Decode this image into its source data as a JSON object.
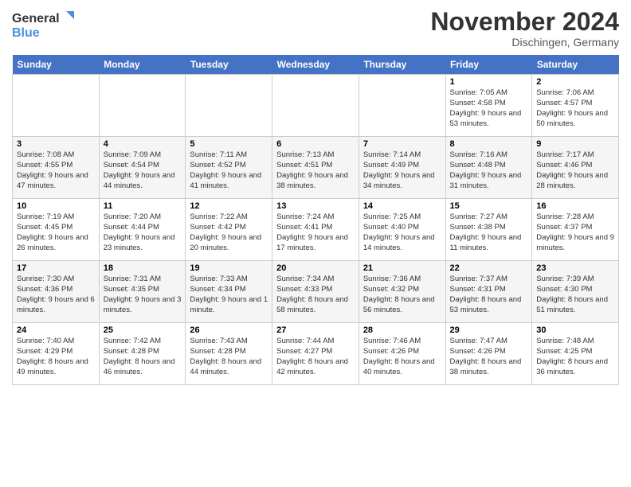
{
  "logo": {
    "line1": "General",
    "line2": "Blue"
  },
  "title": "November 2024",
  "location": "Dischingen, Germany",
  "days_header": [
    "Sunday",
    "Monday",
    "Tuesday",
    "Wednesday",
    "Thursday",
    "Friday",
    "Saturday"
  ],
  "weeks": [
    [
      {
        "day": "",
        "info": ""
      },
      {
        "day": "",
        "info": ""
      },
      {
        "day": "",
        "info": ""
      },
      {
        "day": "",
        "info": ""
      },
      {
        "day": "",
        "info": ""
      },
      {
        "day": "1",
        "info": "Sunrise: 7:05 AM\nSunset: 4:58 PM\nDaylight: 9 hours and 53 minutes."
      },
      {
        "day": "2",
        "info": "Sunrise: 7:06 AM\nSunset: 4:57 PM\nDaylight: 9 hours and 50 minutes."
      }
    ],
    [
      {
        "day": "3",
        "info": "Sunrise: 7:08 AM\nSunset: 4:55 PM\nDaylight: 9 hours and 47 minutes."
      },
      {
        "day": "4",
        "info": "Sunrise: 7:09 AM\nSunset: 4:54 PM\nDaylight: 9 hours and 44 minutes."
      },
      {
        "day": "5",
        "info": "Sunrise: 7:11 AM\nSunset: 4:52 PM\nDaylight: 9 hours and 41 minutes."
      },
      {
        "day": "6",
        "info": "Sunrise: 7:13 AM\nSunset: 4:51 PM\nDaylight: 9 hours and 38 minutes."
      },
      {
        "day": "7",
        "info": "Sunrise: 7:14 AM\nSunset: 4:49 PM\nDaylight: 9 hours and 34 minutes."
      },
      {
        "day": "8",
        "info": "Sunrise: 7:16 AM\nSunset: 4:48 PM\nDaylight: 9 hours and 31 minutes."
      },
      {
        "day": "9",
        "info": "Sunrise: 7:17 AM\nSunset: 4:46 PM\nDaylight: 9 hours and 28 minutes."
      }
    ],
    [
      {
        "day": "10",
        "info": "Sunrise: 7:19 AM\nSunset: 4:45 PM\nDaylight: 9 hours and 26 minutes."
      },
      {
        "day": "11",
        "info": "Sunrise: 7:20 AM\nSunset: 4:44 PM\nDaylight: 9 hours and 23 minutes."
      },
      {
        "day": "12",
        "info": "Sunrise: 7:22 AM\nSunset: 4:42 PM\nDaylight: 9 hours and 20 minutes."
      },
      {
        "day": "13",
        "info": "Sunrise: 7:24 AM\nSunset: 4:41 PM\nDaylight: 9 hours and 17 minutes."
      },
      {
        "day": "14",
        "info": "Sunrise: 7:25 AM\nSunset: 4:40 PM\nDaylight: 9 hours and 14 minutes."
      },
      {
        "day": "15",
        "info": "Sunrise: 7:27 AM\nSunset: 4:38 PM\nDaylight: 9 hours and 11 minutes."
      },
      {
        "day": "16",
        "info": "Sunrise: 7:28 AM\nSunset: 4:37 PM\nDaylight: 9 hours and 9 minutes."
      }
    ],
    [
      {
        "day": "17",
        "info": "Sunrise: 7:30 AM\nSunset: 4:36 PM\nDaylight: 9 hours and 6 minutes."
      },
      {
        "day": "18",
        "info": "Sunrise: 7:31 AM\nSunset: 4:35 PM\nDaylight: 9 hours and 3 minutes."
      },
      {
        "day": "19",
        "info": "Sunrise: 7:33 AM\nSunset: 4:34 PM\nDaylight: 9 hours and 1 minute."
      },
      {
        "day": "20",
        "info": "Sunrise: 7:34 AM\nSunset: 4:33 PM\nDaylight: 8 hours and 58 minutes."
      },
      {
        "day": "21",
        "info": "Sunrise: 7:36 AM\nSunset: 4:32 PM\nDaylight: 8 hours and 56 minutes."
      },
      {
        "day": "22",
        "info": "Sunrise: 7:37 AM\nSunset: 4:31 PM\nDaylight: 8 hours and 53 minutes."
      },
      {
        "day": "23",
        "info": "Sunrise: 7:39 AM\nSunset: 4:30 PM\nDaylight: 8 hours and 51 minutes."
      }
    ],
    [
      {
        "day": "24",
        "info": "Sunrise: 7:40 AM\nSunset: 4:29 PM\nDaylight: 8 hours and 49 minutes."
      },
      {
        "day": "25",
        "info": "Sunrise: 7:42 AM\nSunset: 4:28 PM\nDaylight: 8 hours and 46 minutes."
      },
      {
        "day": "26",
        "info": "Sunrise: 7:43 AM\nSunset: 4:28 PM\nDaylight: 8 hours and 44 minutes."
      },
      {
        "day": "27",
        "info": "Sunrise: 7:44 AM\nSunset: 4:27 PM\nDaylight: 8 hours and 42 minutes."
      },
      {
        "day": "28",
        "info": "Sunrise: 7:46 AM\nSunset: 4:26 PM\nDaylight: 8 hours and 40 minutes."
      },
      {
        "day": "29",
        "info": "Sunrise: 7:47 AM\nSunset: 4:26 PM\nDaylight: 8 hours and 38 minutes."
      },
      {
        "day": "30",
        "info": "Sunrise: 7:48 AM\nSunset: 4:25 PM\nDaylight: 8 hours and 36 minutes."
      }
    ]
  ]
}
